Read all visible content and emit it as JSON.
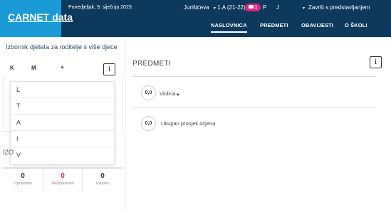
{
  "header": {
    "logo": "CARNET data",
    "date": "Ponedjeljak, 9. siječnja 2023.",
    "school": "Jurišićeva",
    "class": "1.A (21-22)",
    "messages_count": "1",
    "user_initial_1": "P",
    "user_initial_2": "J",
    "finish_label": "Završi s predstavljanjem",
    "nav": [
      "NASLOVNICA",
      "PREDMETI",
      "OBAVIJESTI",
      "O ŠKOLI"
    ]
  },
  "child_selector": {
    "title": "Izbornik djeteta za roditelje s više djece",
    "selected_initial_1": "K",
    "selected_initial_2": "M",
    "info_label": "i",
    "options": [
      "L",
      "T",
      "A",
      "I",
      "V"
    ]
  },
  "absences": {
    "title": "IZO",
    "items": [
      {
        "value": "0",
        "label": "Opravdani"
      },
      {
        "value": "0",
        "label": "Neopravdani"
      },
      {
        "value": "0",
        "label": "Ukupno"
      }
    ]
  },
  "subjects": {
    "title": "PREDMETI",
    "info_label": "i",
    "rows": [
      {
        "grade": "0,0",
        "name": "Violina"
      }
    ],
    "overall": {
      "grade": "0,0",
      "label": "Ukupan prosjek ocjena"
    }
  },
  "colors": {
    "header_bg": "#0d3a5c",
    "logo_bg": "#1a9ad6",
    "accent_pink": "#e0237b"
  }
}
